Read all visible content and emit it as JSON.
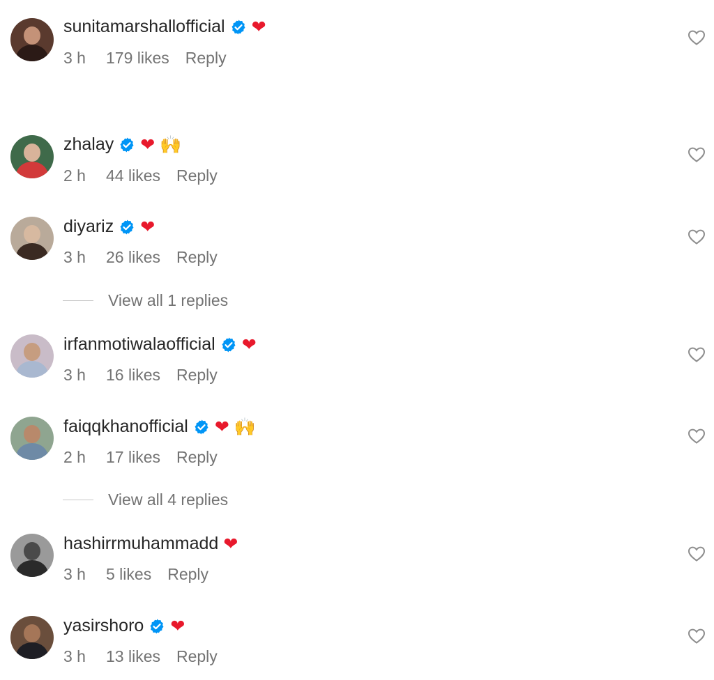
{
  "comments": [
    {
      "username": "sunitamarshallofficial",
      "emojis": [
        "❤"
      ],
      "time": "3 h",
      "likes": "179 likes",
      "reply": "Reply",
      "avatar": {
        "bg": "#5a3a2e",
        "skin": "#c49278",
        "cloth": "#2b1a16"
      }
    },
    {
      "username": "zhalay",
      "emojis": [
        "❤",
        "🙌"
      ],
      "time": "2 h",
      "likes": "44 likes",
      "reply": "Reply",
      "avatar": {
        "bg": "#3f6a4a",
        "skin": "#d8b39a",
        "cloth": "#d23a3a"
      }
    },
    {
      "username": "diyariz",
      "emojis": [
        "❤"
      ],
      "time": "3 h",
      "likes": "26 likes",
      "reply": "Reply",
      "avatar": {
        "bg": "#b9aa9a",
        "skin": "#d7b9a0",
        "cloth": "#3a2a22"
      }
    },
    {
      "username": "irfanmotiwalaofficial",
      "emojis": [
        "❤"
      ],
      "time": "3 h",
      "likes": "16 likes",
      "reply": "Reply",
      "avatar": {
        "bg": "#c9bcc8",
        "skin": "#c69d80",
        "cloth": "#a9b8d0"
      }
    },
    {
      "username": "faiqqkhanofficial",
      "emojis": [
        "❤",
        "🙌"
      ],
      "time": "2 h",
      "likes": "17 likes",
      "reply": "Reply",
      "avatar": {
        "bg": "#8fa590",
        "skin": "#b8896b",
        "cloth": "#6e8aa6"
      }
    },
    {
      "username": "hashirrmuhammadd",
      "emojis": [
        "❤"
      ],
      "time": "3 h",
      "likes": "5 likes",
      "reply": "Reply",
      "avatar": {
        "bg": "#9a9a9a",
        "skin": "#4a4a4a",
        "cloth": "#2a2a2a"
      }
    },
    {
      "username": "yasirshoro",
      "emojis": [
        "❤"
      ],
      "time": "3 h",
      "likes": "13 likes",
      "reply": "Reply",
      "avatar": {
        "bg": "#6a4e3c",
        "skin": "#a57658",
        "cloth": "#1e1e24"
      }
    }
  ],
  "view_replies": [
    {
      "label": "View all 1 replies"
    },
    {
      "label": "View all 4 replies"
    }
  ],
  "colors": {
    "verified": "#0095f6",
    "heart": "#e8192c",
    "meta": "#737373"
  },
  "icons": {
    "verified": "verified-badge-icon",
    "like": "heart-outline-icon"
  }
}
